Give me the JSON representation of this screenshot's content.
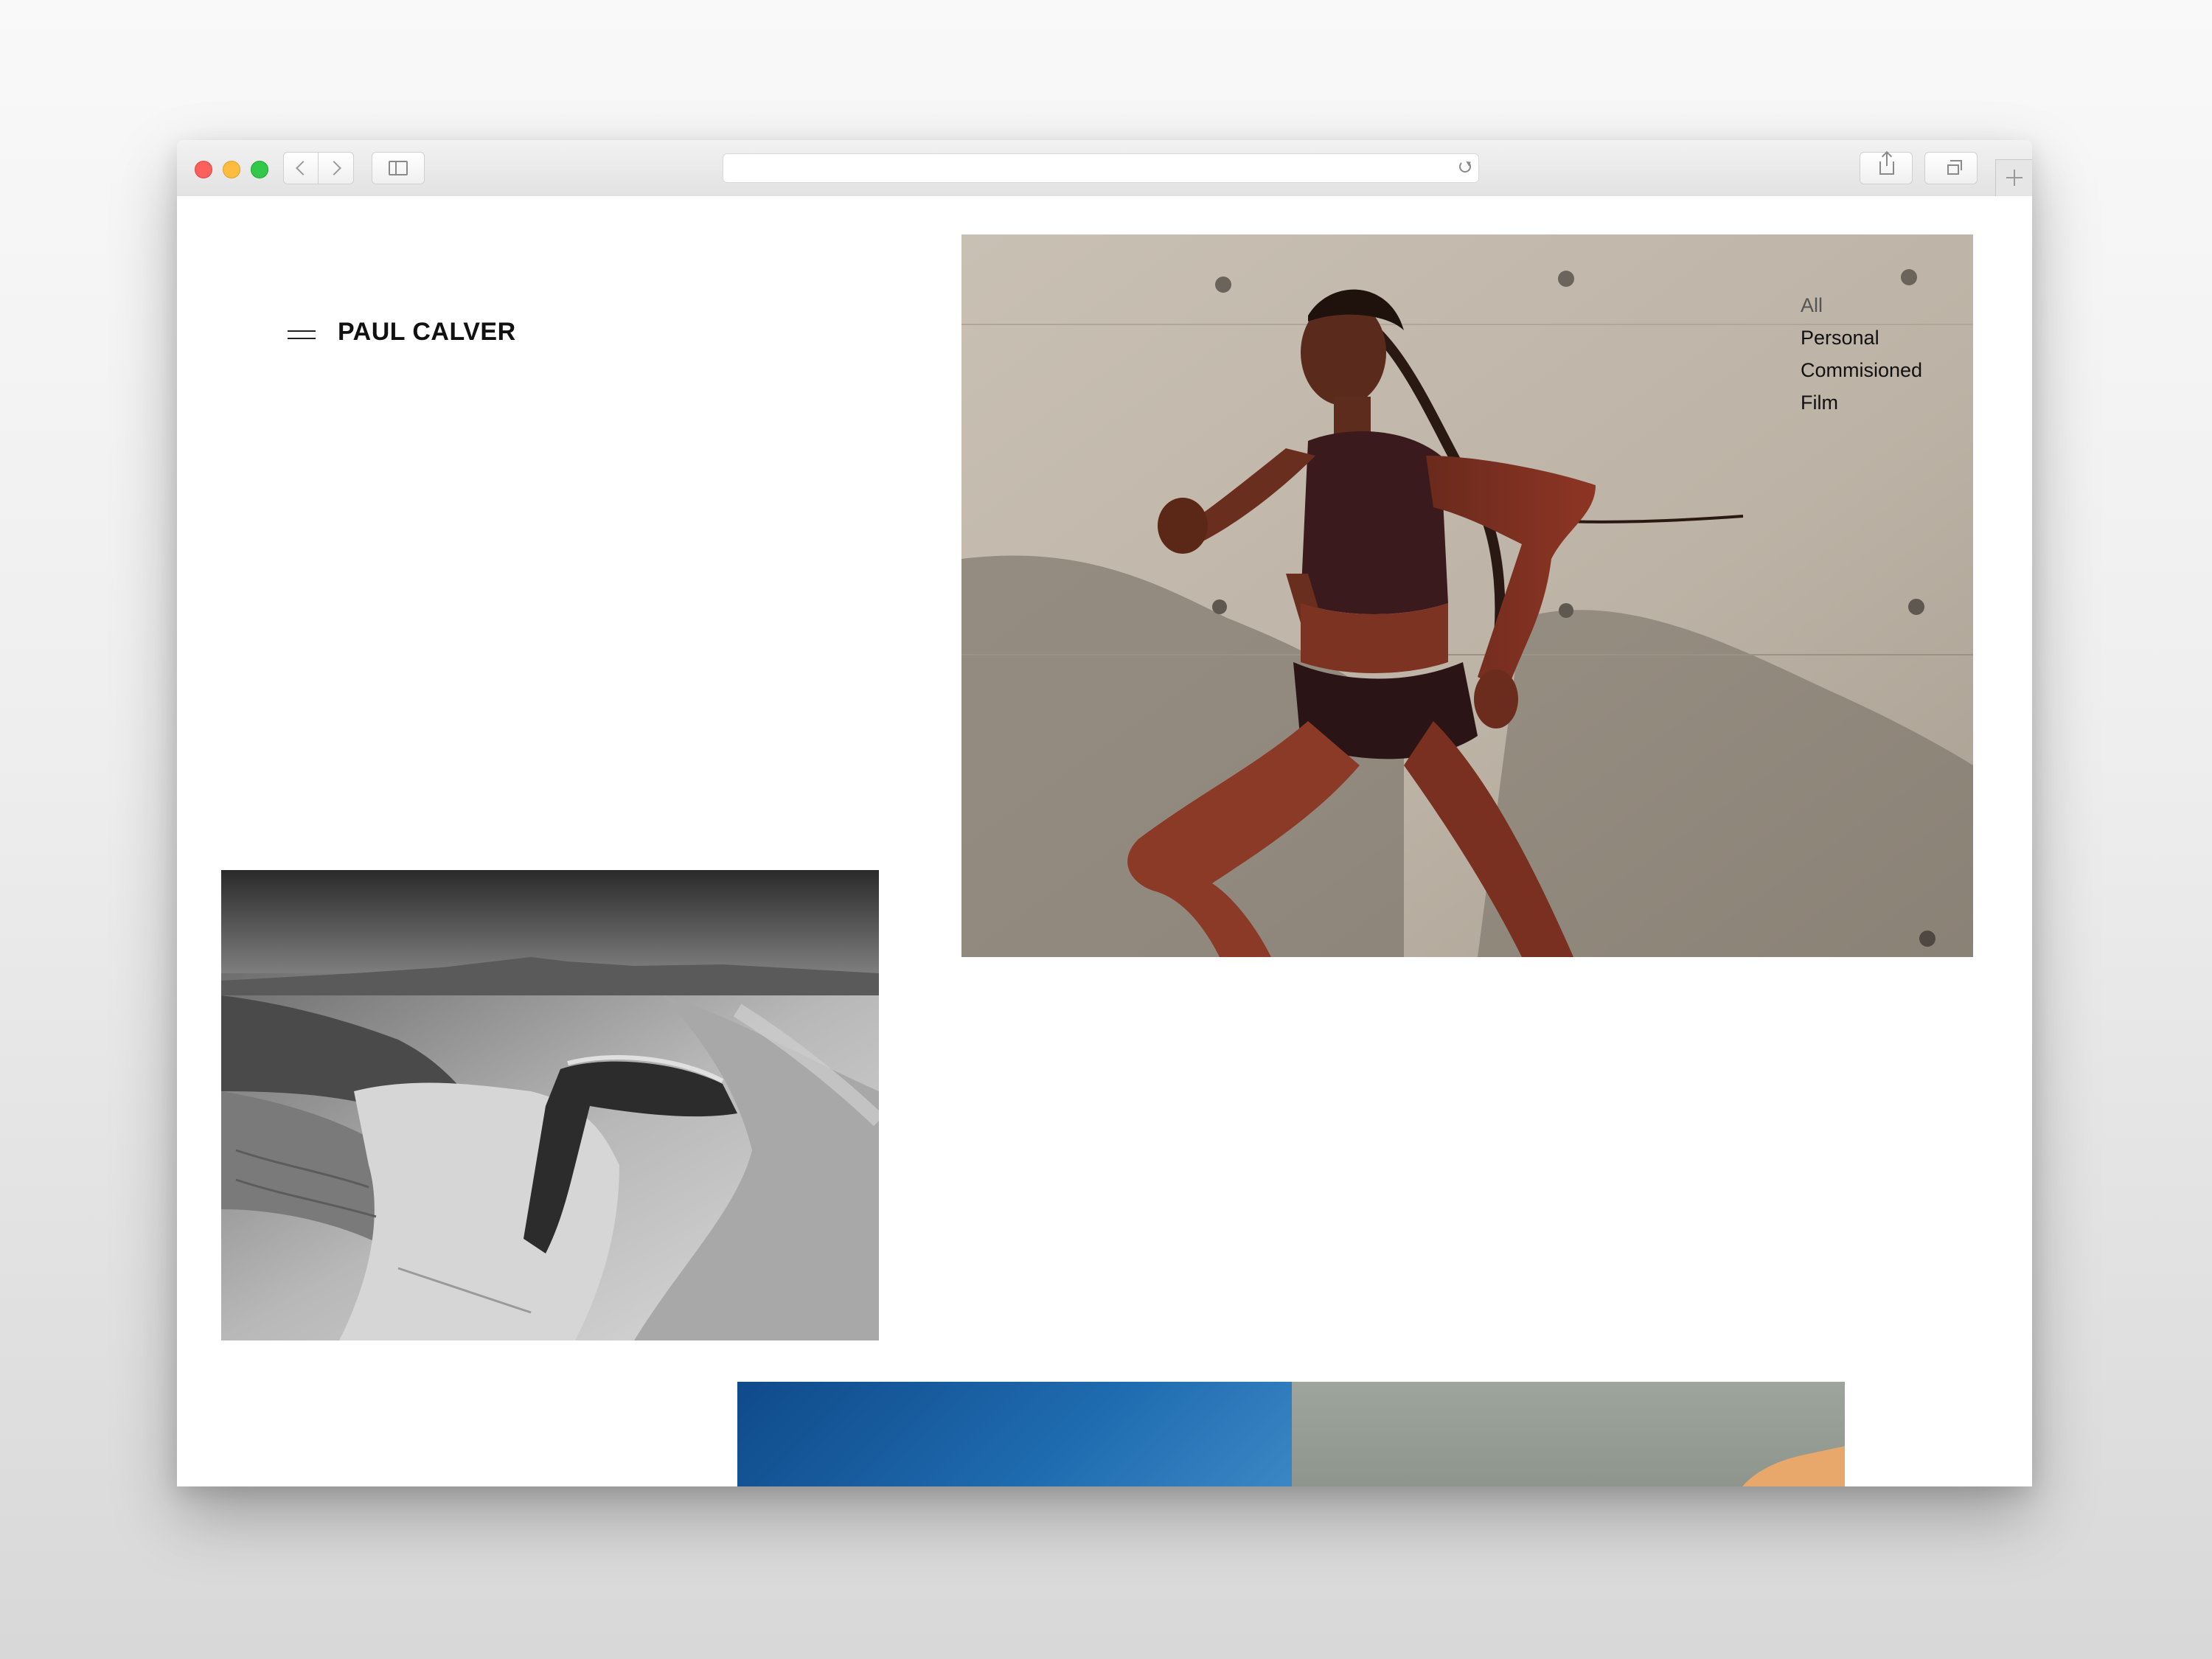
{
  "browser": {
    "address": ""
  },
  "site": {
    "title": "PAUL CALVER"
  },
  "filters": [
    {
      "label": "All",
      "active": true
    },
    {
      "label": "Personal",
      "active": false
    },
    {
      "label": "Commisioned",
      "active": false
    },
    {
      "label": "Film",
      "active": false
    }
  ],
  "colors": {
    "traffic_close": "#fc605c",
    "traffic_minimize": "#fdbc40",
    "traffic_maximize": "#34c84a",
    "title_text": "#111111",
    "filter_active": "#555555"
  },
  "icons": {
    "menu": "hamburger-icon",
    "back": "chevron-left-icon",
    "forward": "chevron-right-icon",
    "sidebar": "sidebar-icon",
    "share": "share-icon",
    "tabs": "tabs-icon",
    "new_tab": "plus-icon",
    "reload": "reload-icon"
  }
}
